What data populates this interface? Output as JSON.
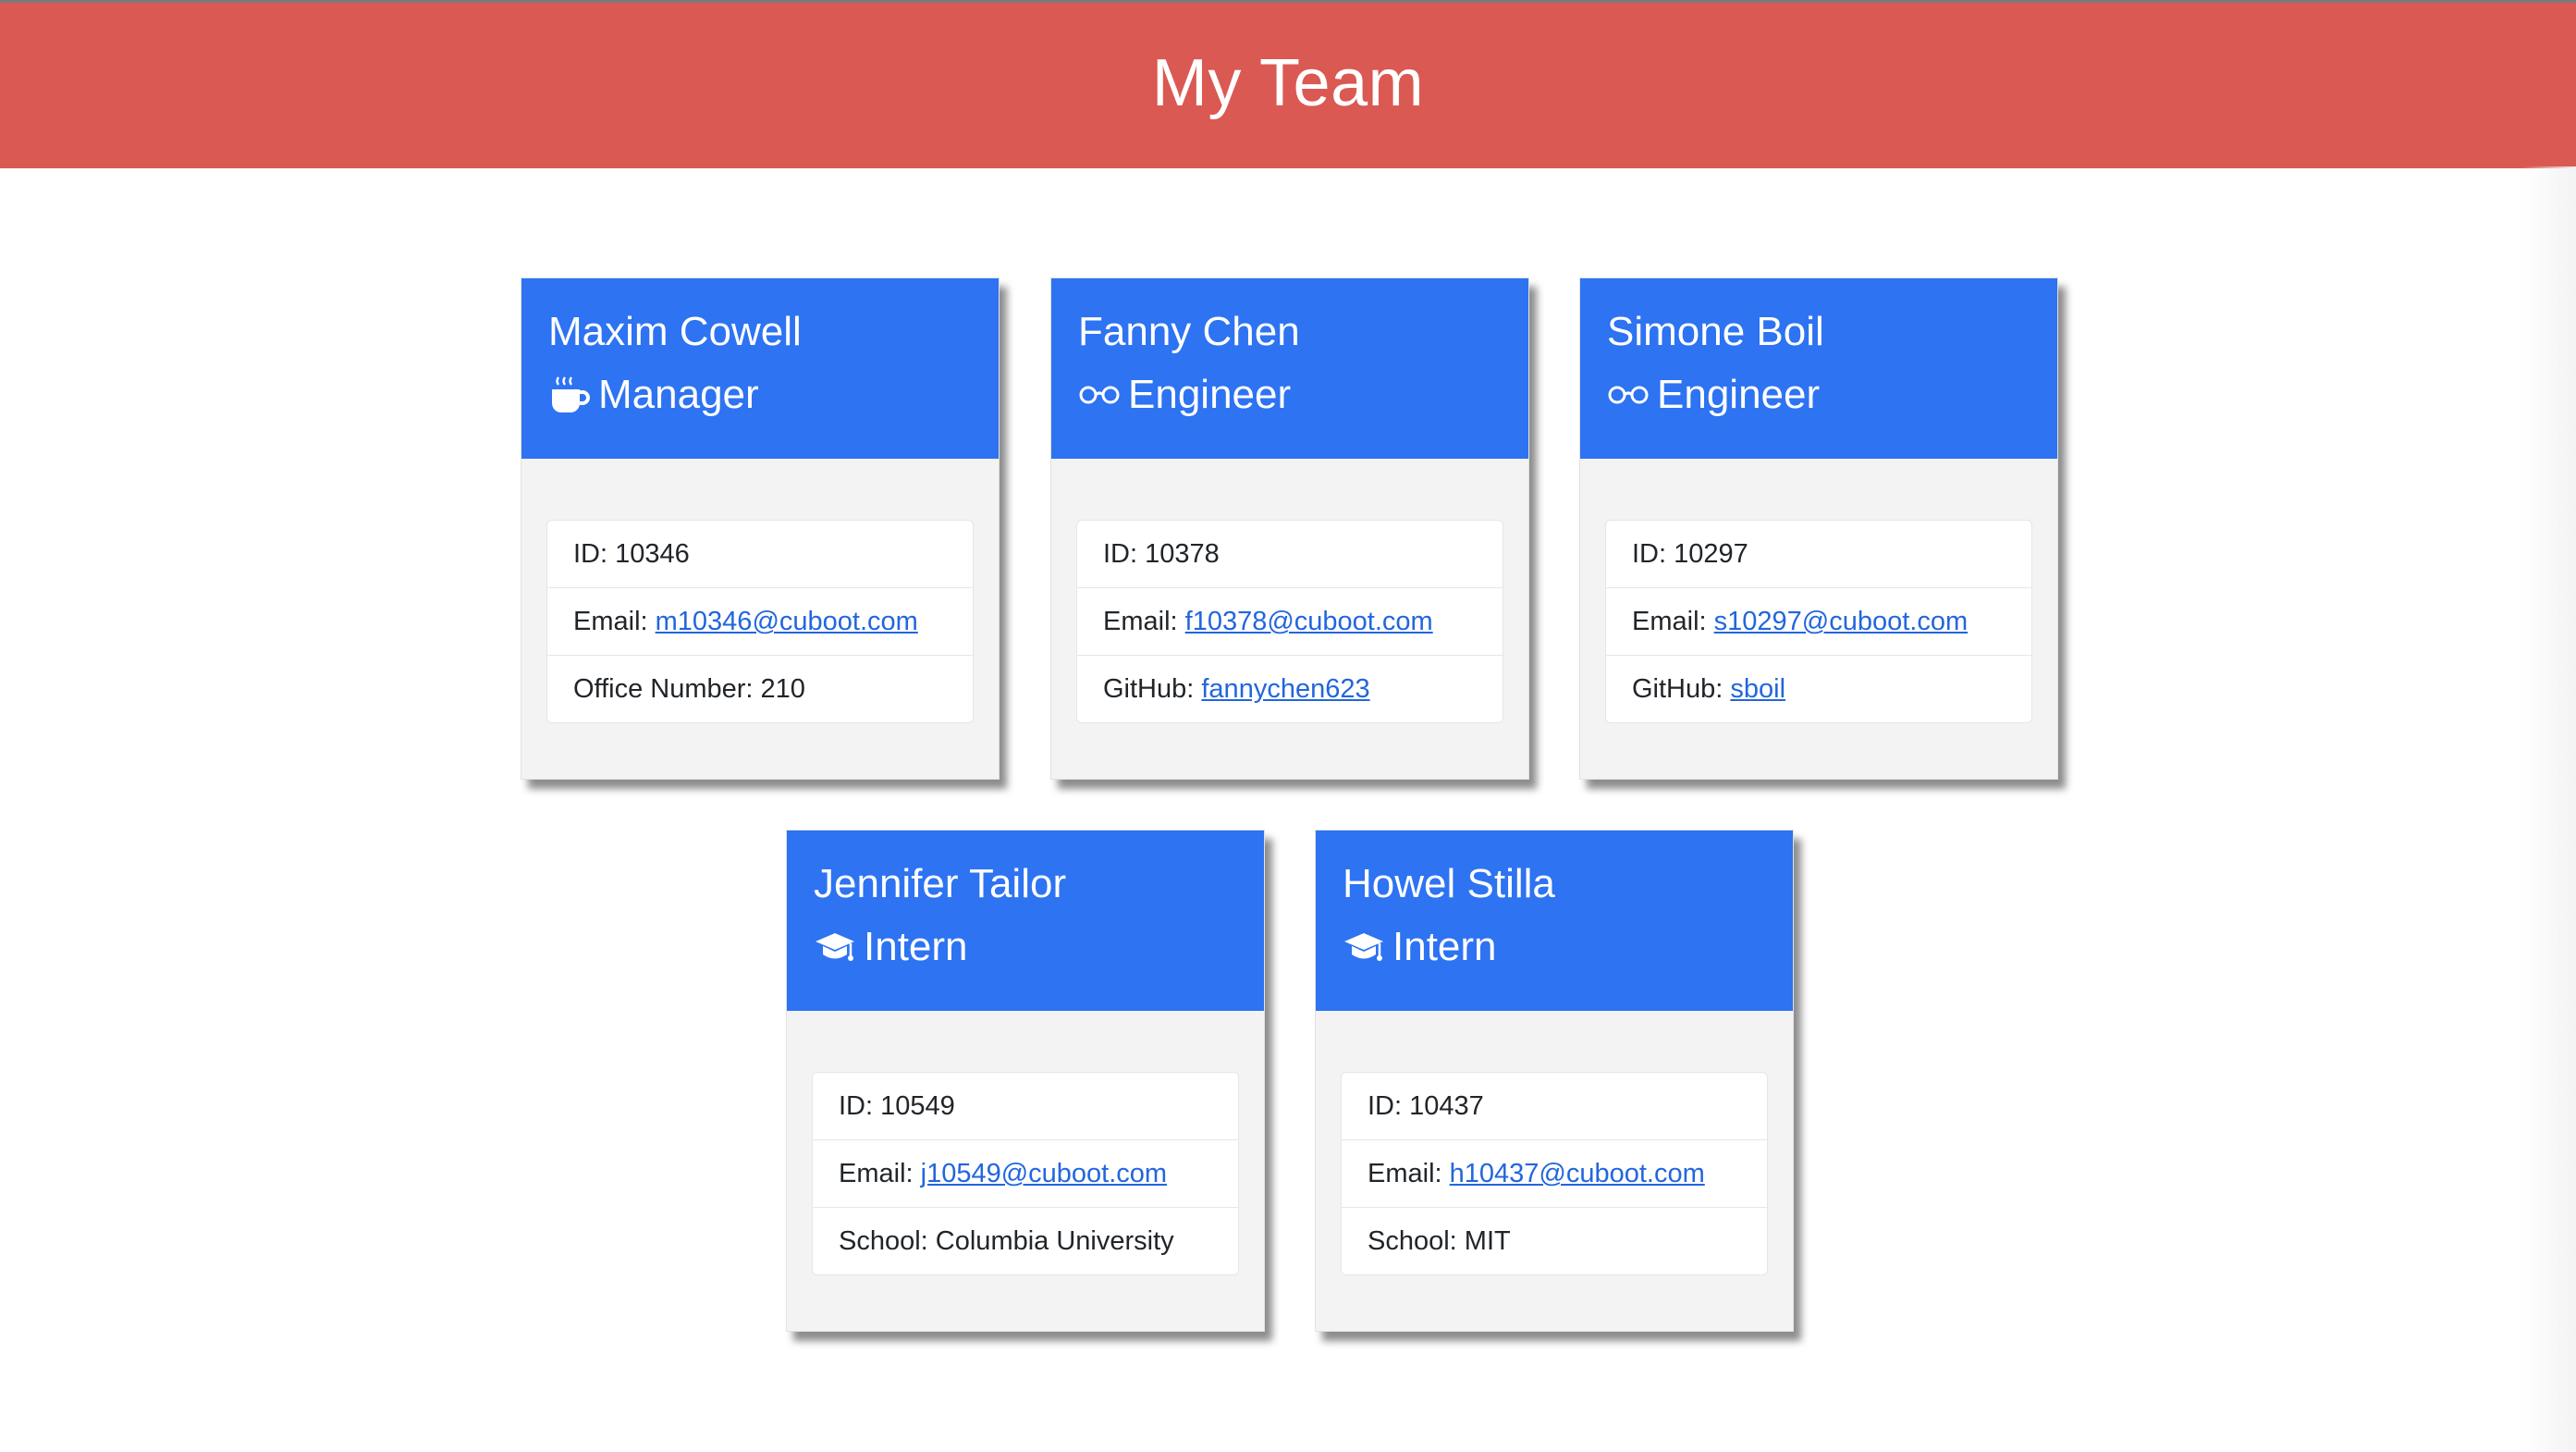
{
  "page": {
    "title": "My Team"
  },
  "colors": {
    "header_bg": "#da5953",
    "card_header_bg": "#2d73f2",
    "card_body_bg": "#f3f3f3",
    "link": "#2266dd"
  },
  "team": [
    {
      "name": "Maxim Cowell",
      "role": "Manager",
      "role_icon": "mug-hot-icon",
      "id_label": "ID: ",
      "id": "10346",
      "email_label": "Email: ",
      "email": "m10346@cuboot.com",
      "extra_label": "Office Number: ",
      "extra_value": "210"
    },
    {
      "name": "Fanny Chen",
      "role": "Engineer",
      "role_icon": "glasses-icon",
      "id_label": "ID: ",
      "id": "10378",
      "email_label": "Email: ",
      "email": "f10378@cuboot.com",
      "extra_label": "GitHub: ",
      "extra_value": "fannychen623"
    },
    {
      "name": "Simone Boil",
      "role": "Engineer",
      "role_icon": "glasses-icon",
      "id_label": "ID: ",
      "id": "10297",
      "email_label": "Email: ",
      "email": "s10297@cuboot.com",
      "extra_label": "GitHub: ",
      "extra_value": "sboil"
    },
    {
      "name": "Jennifer Tailor",
      "role": "Intern",
      "role_icon": "graduation-cap-icon",
      "id_label": "ID: ",
      "id": "10549",
      "email_label": "Email: ",
      "email": "j10549@cuboot.com",
      "extra_label": "School: ",
      "extra_value": "Columbia University"
    },
    {
      "name": "Howel Stilla",
      "role": "Intern",
      "role_icon": "graduation-cap-icon",
      "id_label": "ID: ",
      "id": "10437",
      "email_label": "Email: ",
      "email": "h10437@cuboot.com",
      "extra_label": "School: ",
      "extra_value": "MIT"
    }
  ]
}
